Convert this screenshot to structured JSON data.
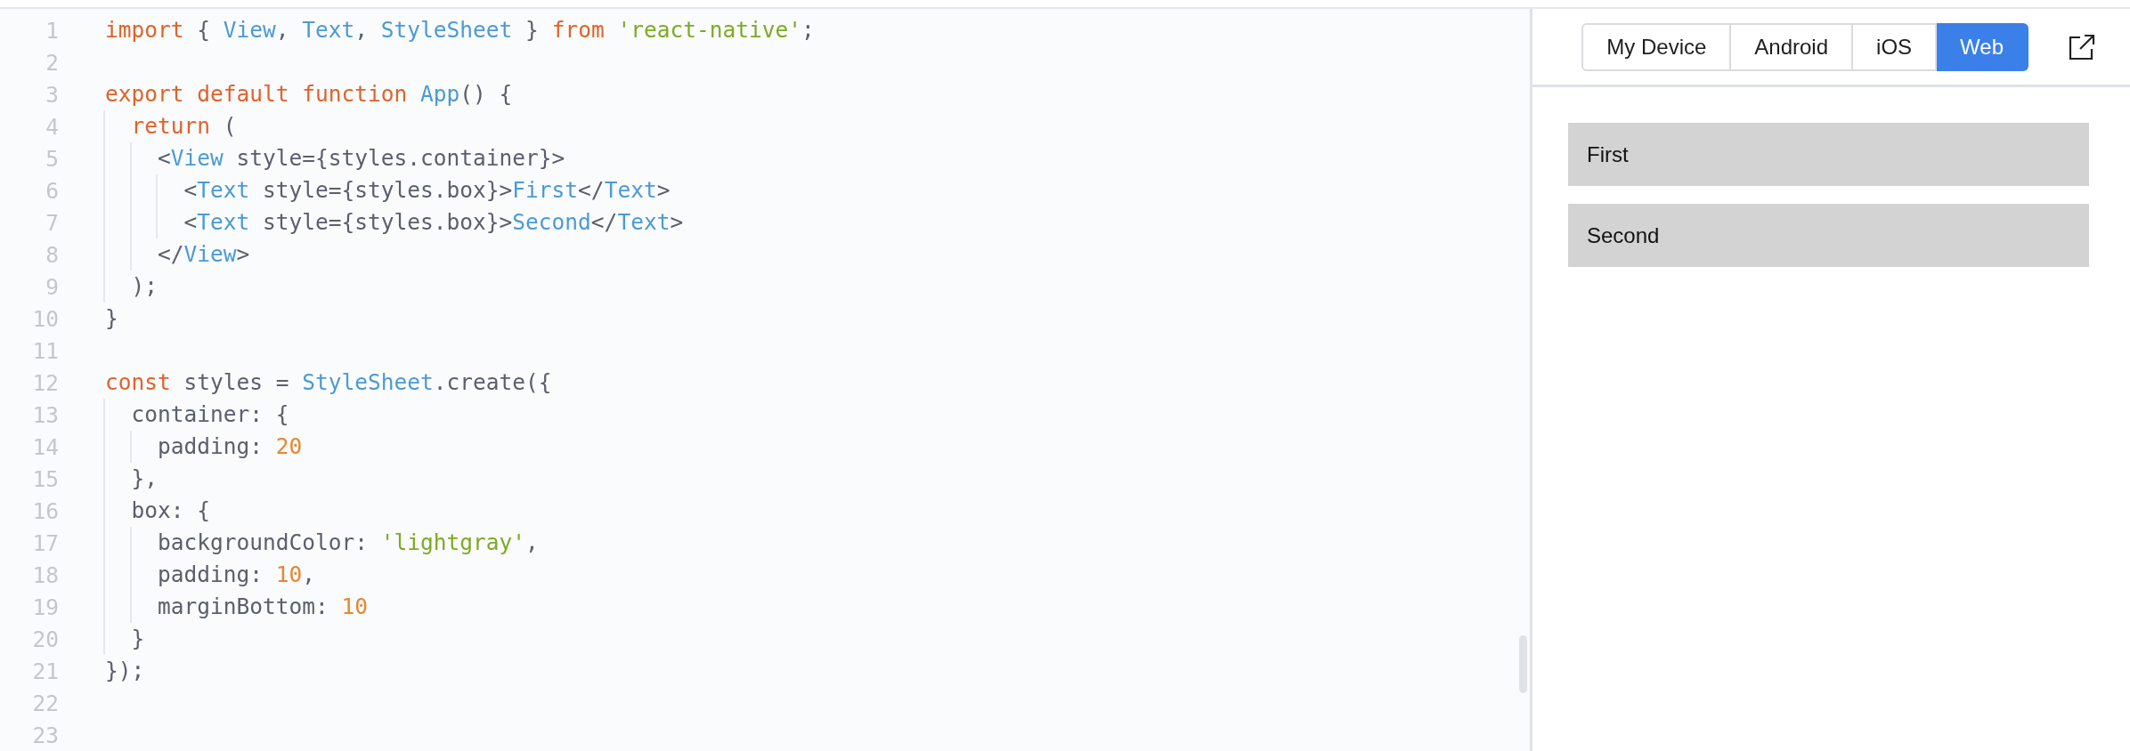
{
  "editor": {
    "lines": [
      {
        "number": "1",
        "tokens": [
          {
            "kind": "keyword",
            "text": "import"
          },
          {
            "kind": "plain",
            "text": " { "
          },
          {
            "kind": "ident",
            "text": "View"
          },
          {
            "kind": "plain",
            "text": ", "
          },
          {
            "kind": "ident",
            "text": "Text"
          },
          {
            "kind": "plain",
            "text": ", "
          },
          {
            "kind": "ident",
            "text": "StyleSheet"
          },
          {
            "kind": "plain",
            "text": " } "
          },
          {
            "kind": "keyword",
            "text": "from "
          },
          {
            "kind": "string",
            "text": "'react-native'"
          },
          {
            "kind": "plain",
            "text": ";"
          }
        ]
      },
      {
        "number": "2"
      },
      {
        "number": "3",
        "tokens": [
          {
            "kind": "keyword",
            "text": "export default function "
          },
          {
            "kind": "ident",
            "text": "App"
          },
          {
            "kind": "plain",
            "text": "() {"
          }
        ]
      },
      {
        "number": "4",
        "tokens": [
          {
            "kind": "keyword",
            "text": "  return"
          },
          {
            "kind": "plain",
            "text": " ("
          }
        ]
      },
      {
        "number": "5",
        "tokens": [
          {
            "kind": "plain",
            "text": "    <"
          },
          {
            "kind": "ident",
            "text": "View"
          },
          {
            "kind": "plain",
            "text": " style={styles.container}>"
          }
        ]
      },
      {
        "number": "6",
        "tokens": [
          {
            "kind": "plain",
            "text": "      <"
          },
          {
            "kind": "ident",
            "text": "Text"
          },
          {
            "kind": "plain",
            "text": " style={styles.box}>"
          },
          {
            "kind": "ident",
            "text": "First"
          },
          {
            "kind": "plain",
            "text": "</"
          },
          {
            "kind": "ident",
            "text": "Text"
          },
          {
            "kind": "plain",
            "text": ">"
          }
        ]
      },
      {
        "number": "7",
        "tokens": [
          {
            "kind": "plain",
            "text": "      <"
          },
          {
            "kind": "ident",
            "text": "Text"
          },
          {
            "kind": "plain",
            "text": " style={styles.box}>"
          },
          {
            "kind": "ident",
            "text": "Second"
          },
          {
            "kind": "plain",
            "text": "</"
          },
          {
            "kind": "ident",
            "text": "Text"
          },
          {
            "kind": "plain",
            "text": ">"
          }
        ]
      },
      {
        "number": "8",
        "tokens": [
          {
            "kind": "plain",
            "text": "    </"
          },
          {
            "kind": "ident",
            "text": "View"
          },
          {
            "kind": "plain",
            "text": ">"
          }
        ]
      },
      {
        "number": "9",
        "tokens": [
          {
            "kind": "plain",
            "text": "  );"
          }
        ]
      },
      {
        "number": "10",
        "tokens": [
          {
            "kind": "plain",
            "text": "}"
          }
        ]
      },
      {
        "number": "11"
      },
      {
        "number": "12",
        "tokens": [
          {
            "kind": "keyword",
            "text": "const"
          },
          {
            "kind": "plain",
            "text": " styles = "
          },
          {
            "kind": "ident",
            "text": "StyleSheet"
          },
          {
            "kind": "plain",
            "text": ".create({"
          }
        ]
      },
      {
        "number": "13",
        "tokens": [
          {
            "kind": "plain",
            "text": "  container: {"
          }
        ]
      },
      {
        "number": "14",
        "tokens": [
          {
            "kind": "plain",
            "text": "    padding: "
          },
          {
            "kind": "number",
            "text": "20"
          }
        ]
      },
      {
        "number": "15",
        "tokens": [
          {
            "kind": "plain",
            "text": "  },"
          }
        ]
      },
      {
        "number": "16",
        "tokens": [
          {
            "kind": "plain",
            "text": "  box: {"
          }
        ]
      },
      {
        "number": "17",
        "tokens": [
          {
            "kind": "plain",
            "text": "    backgroundColor: "
          },
          {
            "kind": "string",
            "text": "'lightgray'"
          },
          {
            "kind": "plain",
            "text": ","
          }
        ]
      },
      {
        "number": "18",
        "tokens": [
          {
            "kind": "plain",
            "text": "    padding: "
          },
          {
            "kind": "number",
            "text": "10"
          },
          {
            "kind": "plain",
            "text": ","
          }
        ]
      },
      {
        "number": "19",
        "tokens": [
          {
            "kind": "plain",
            "text": "    marginBottom: "
          },
          {
            "kind": "number",
            "text": "10"
          }
        ]
      },
      {
        "number": "20",
        "tokens": [
          {
            "kind": "plain",
            "text": "  }"
          }
        ]
      },
      {
        "number": "21",
        "tokens": [
          {
            "kind": "plain",
            "text": "});"
          }
        ]
      },
      {
        "number": "22"
      },
      {
        "number": "23"
      }
    ]
  },
  "preview": {
    "tabs": [
      {
        "label": "My Device",
        "selected": false
      },
      {
        "label": "Android",
        "selected": false
      },
      {
        "label": "iOS",
        "selected": false
      },
      {
        "label": "Web",
        "selected": true
      }
    ],
    "boxes": [
      "First",
      "Second"
    ]
  }
}
